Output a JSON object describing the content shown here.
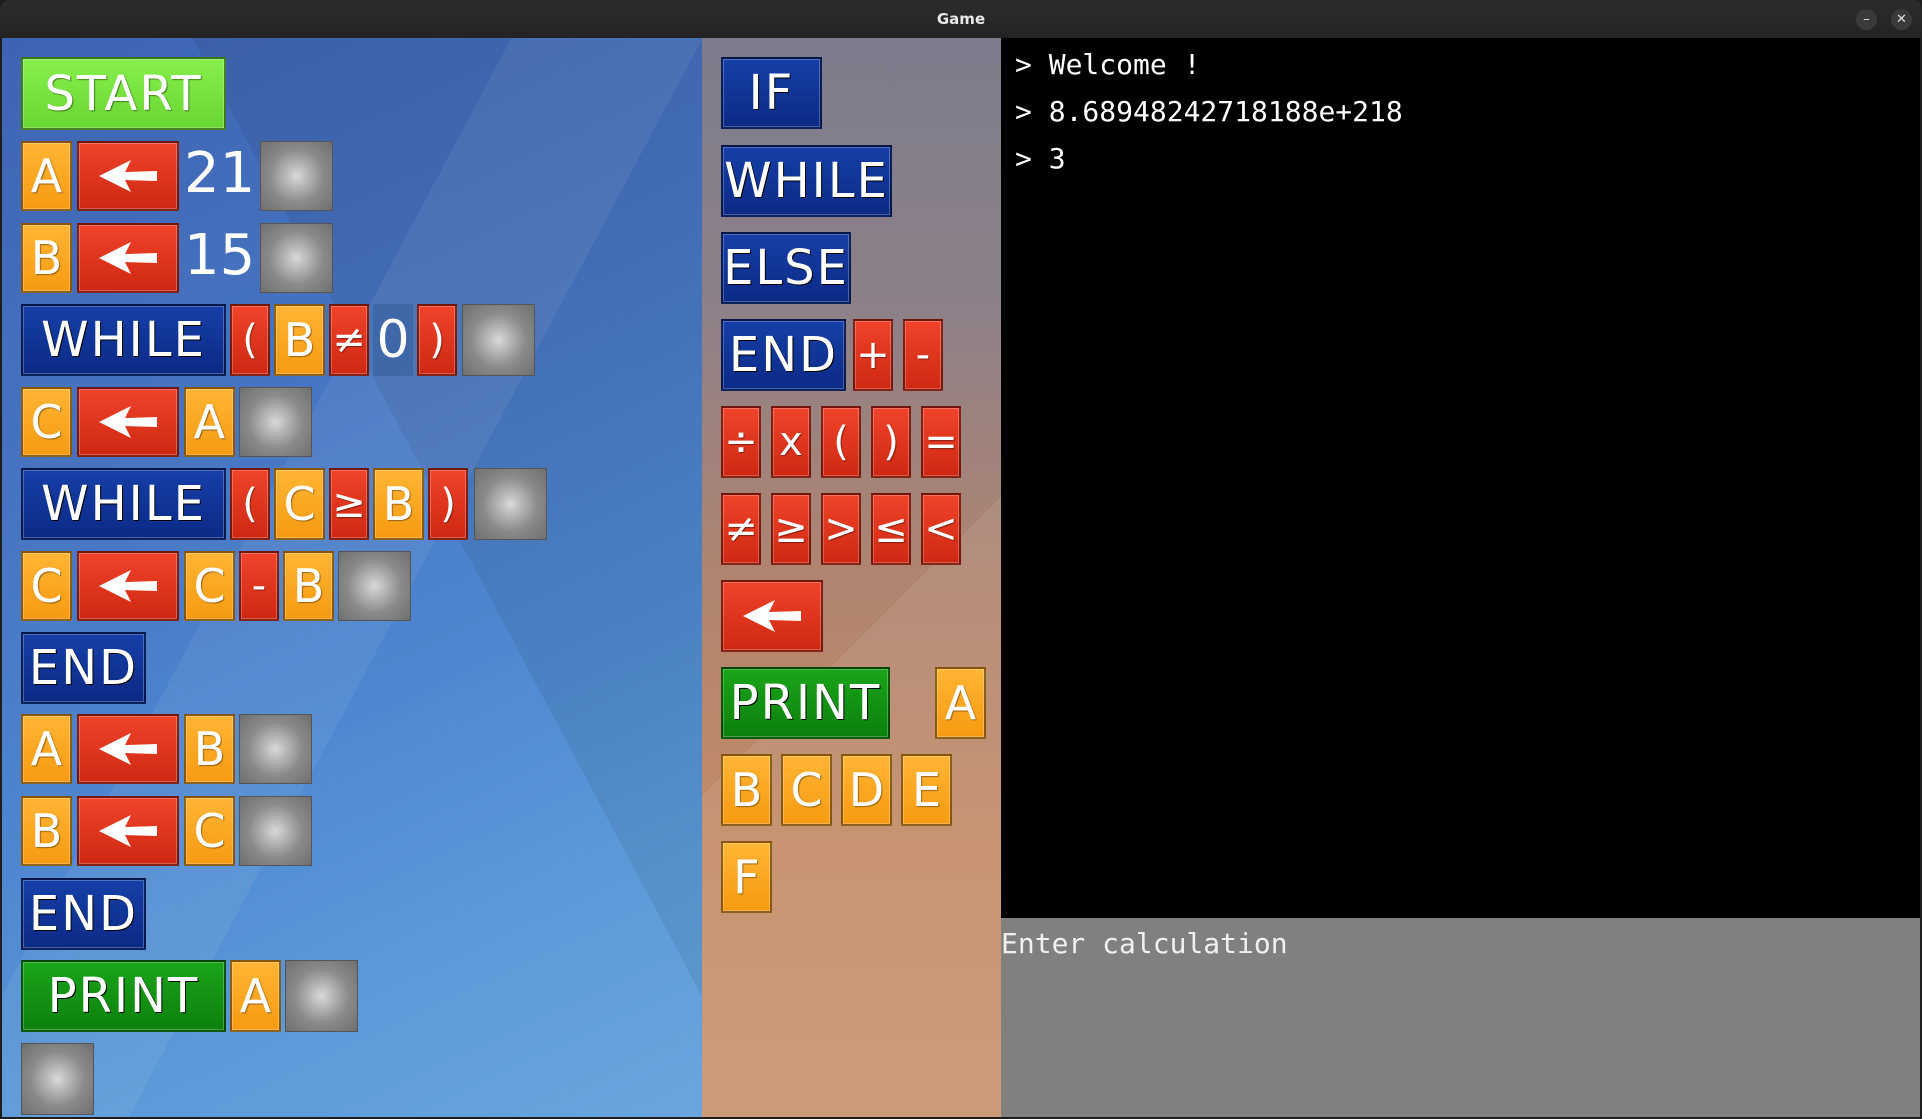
{
  "window": {
    "title": "Game",
    "minimize_glyph": "–",
    "close_glyph": "✕"
  },
  "program": {
    "start": "START",
    "kw_while": "WHILE",
    "kw_end": "END",
    "kw_print": "PRINT",
    "var_a": "A",
    "var_b": "B",
    "var_c": "C",
    "num_21": "21",
    "num_15": "15",
    "num_0": "0",
    "op_lparen": "(",
    "op_rparen": ")",
    "op_neq": "≠",
    "op_geq": "≥",
    "op_minus": "-"
  },
  "palette": {
    "if": "IF",
    "while": "WHILE",
    "else": "ELSE",
    "end": "END",
    "print": "PRINT",
    "ops": [
      "+",
      "-",
      "÷",
      "x",
      "(",
      ")",
      "=",
      "≠",
      "≥",
      ">",
      "≤",
      "<"
    ],
    "vars": [
      "A",
      "B",
      "C",
      "D",
      "E",
      "F"
    ]
  },
  "console": {
    "prompt": ">",
    "lines": [
      "Welcome !",
      "8.68948242718188e+218",
      "3"
    ]
  },
  "input": {
    "placeholder": "Enter calculation"
  },
  "colors": {
    "keyword": "#0b2a86",
    "start": "#7ce640",
    "print": "#0f8f0f",
    "variable": "#ffa820",
    "operator": "#e0341c",
    "console_bg": "#000000",
    "input_bg": "#808080"
  },
  "icons": {
    "assign": "left-arrow-icon",
    "empty_slot": "drop-slot-icon"
  }
}
